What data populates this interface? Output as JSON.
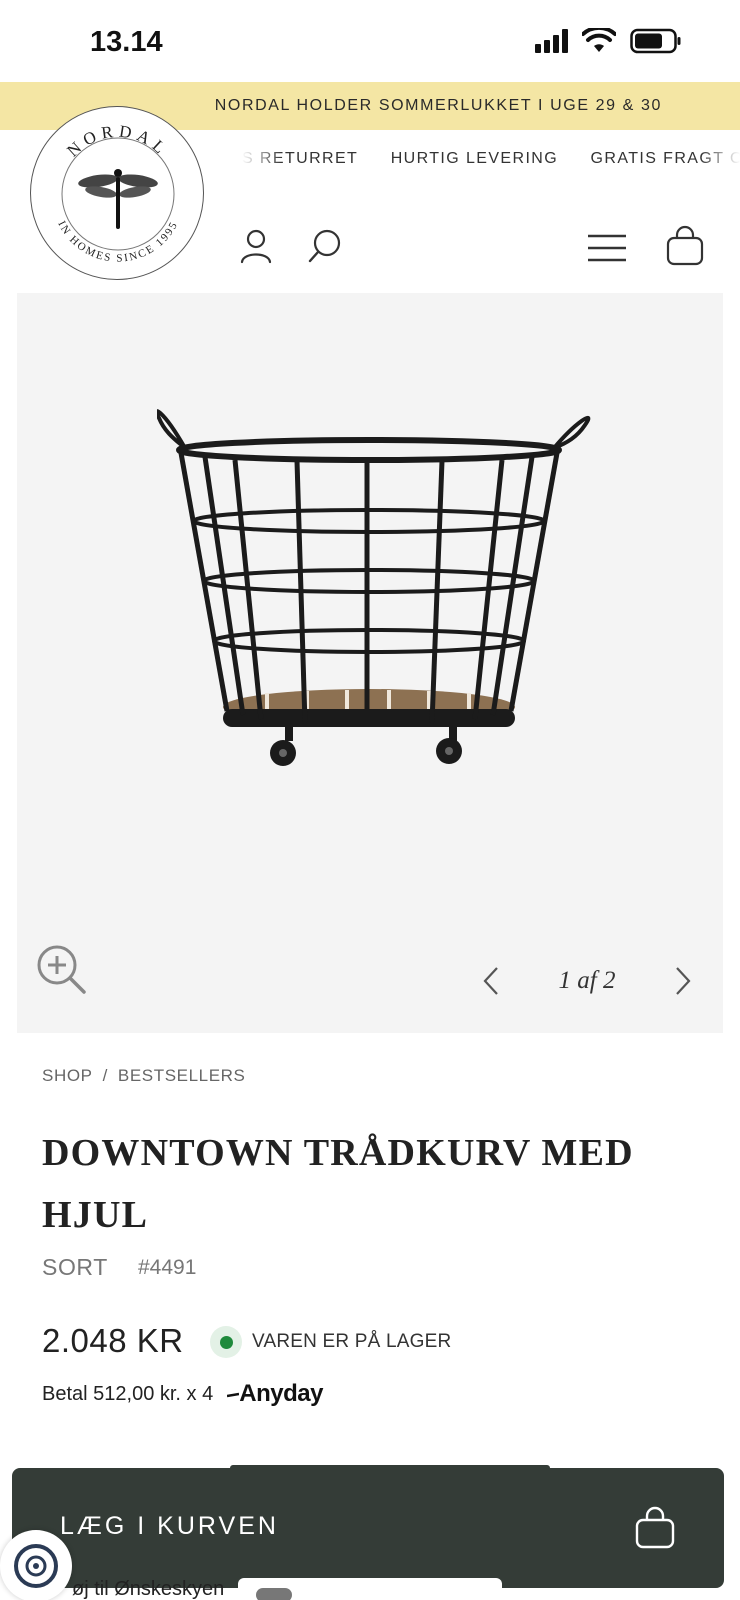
{
  "status_bar": {
    "time": "13.14",
    "icons": [
      "cellular-signal-icon",
      "wifi-icon",
      "battery-icon"
    ]
  },
  "announcement": {
    "text": "NORDAL HOLDER SOMMERLUKKET I UGE 29 & 30",
    "background": "#f4e6a4"
  },
  "header": {
    "logo": {
      "brand": "NORDAL",
      "tagline": "IN HOMES SINCE 1995"
    },
    "usps": [
      "S RETURRET",
      "HURTIG LEVERING",
      "GRATIS FRAGT OVER"
    ],
    "icons": [
      "account-icon",
      "search-icon",
      "menu-icon",
      "cart-icon"
    ]
  },
  "gallery": {
    "product_image": "wire-basket-on-wheels",
    "zoom_icon": "zoom-in-icon",
    "pager_text": "1 af 2",
    "current_image": 1,
    "image_count": 2
  },
  "breadcrumb": {
    "items": [
      "SHOP",
      "BESTSELLERS"
    ],
    "separator": "/"
  },
  "product": {
    "title": "DOWNTOWN TRÅDKURV MED HJUL",
    "variant": "SORT",
    "sku": "#4491",
    "price": "2.048 KR",
    "stock_text": "VAREN ER PÅ LAGER",
    "stock_color": "#1f8a3c",
    "installment_text": "Betal 512,00 kr. x 4",
    "installment_provider": "Anyday"
  },
  "actions": {
    "add_to_cart_label": "LÆG I KURVEN",
    "add_to_cart_color": "#343c37",
    "wishlist_label": "øj til Ønskeskyen"
  }
}
